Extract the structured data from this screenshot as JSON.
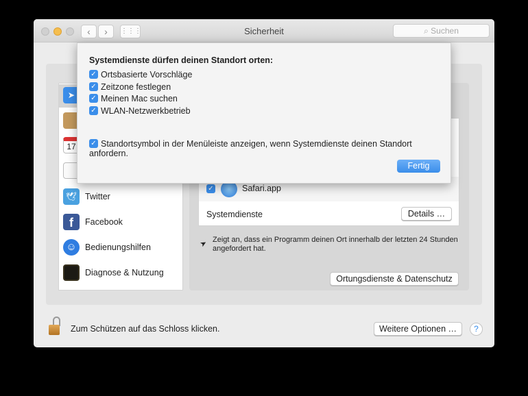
{
  "window": {
    "title": "Sicherheit",
    "search_placeholder": "Suchen"
  },
  "sidebar": {
    "items": [
      {
        "label": "",
        "icon": "location-icon"
      },
      {
        "label": "",
        "icon": "contacts-icon"
      },
      {
        "label": "",
        "icon": "calendar-icon",
        "day": "17"
      },
      {
        "label": "",
        "icon": "reminders-icon"
      },
      {
        "label": "Twitter",
        "icon": "twitter-icon"
      },
      {
        "label": "Facebook",
        "icon": "facebook-icon"
      },
      {
        "label": "Bedienungshilfen",
        "icon": "accessibility-icon"
      },
      {
        "label": "Diagnose & Nutzung",
        "icon": "diagnostics-icon"
      }
    ]
  },
  "main": {
    "apps": [
      {
        "label": "Safari.app",
        "checked": true
      }
    ],
    "system_services_label": "Systemdienste",
    "details_button": "Details …",
    "note": "Zeigt an, dass ein Programm deinen Ort innerhalb der letzten 24 Stunden angefordert hat.",
    "privacy_button": "Ortungsdienste & Datenschutz"
  },
  "footer": {
    "lock_text": "Zum Schützen auf das Schloss klicken.",
    "more_options": "Weitere Optionen …",
    "help": "?"
  },
  "sheet": {
    "heading": "Systemdienste dürfen deinen Standort orten:",
    "options": [
      {
        "label": "Ortsbasierte Vorschläge",
        "checked": true
      },
      {
        "label": "Zeitzone festlegen",
        "checked": true
      },
      {
        "label": "Meinen Mac suchen",
        "checked": true
      },
      {
        "label": "WLAN-Netzwerkbetrieb",
        "checked": true
      }
    ],
    "menu_option": {
      "label": "Standortsymbol in der Menüleiste anzeigen, wenn Systemdienste deinen Standort anfordern.",
      "checked": true
    },
    "done": "Fertig"
  },
  "colors": {
    "accent": "#3b8eea"
  }
}
